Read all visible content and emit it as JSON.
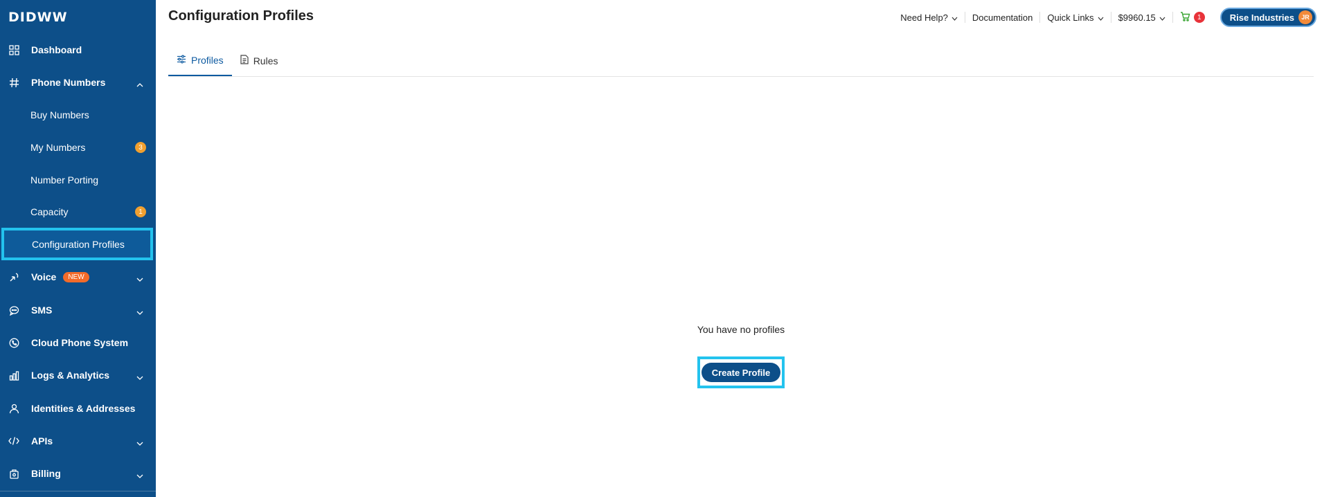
{
  "brand": {
    "logo": "DIDWW"
  },
  "page": {
    "title": "Configuration Profiles"
  },
  "topbar": {
    "need_help": "Need Help?",
    "documentation": "Documentation",
    "quick_links": "Quick Links",
    "balance": "$9960.15",
    "cart_count": "1",
    "account_name": "Rise Industries",
    "avatar_initials": "JR"
  },
  "sidebar": {
    "items": [
      {
        "label": "Dashboard"
      },
      {
        "label": "Phone Numbers"
      },
      {
        "label": "Buy Numbers"
      },
      {
        "label": "My Numbers",
        "badge": "3"
      },
      {
        "label": "Number Porting"
      },
      {
        "label": "Capacity",
        "badge": "1"
      },
      {
        "label": "Configuration Profiles"
      },
      {
        "label": "Voice",
        "tag": "NEW"
      },
      {
        "label": "SMS"
      },
      {
        "label": "Cloud Phone System"
      },
      {
        "label": "Logs & Analytics"
      },
      {
        "label": "Identities & Addresses"
      },
      {
        "label": "APIs"
      },
      {
        "label": "Billing"
      }
    ]
  },
  "tabs": [
    {
      "label": "Profiles",
      "active": true
    },
    {
      "label": "Rules",
      "active": false
    }
  ],
  "empty_state": {
    "message": "You have no profiles",
    "button": "Create Profile"
  },
  "colors": {
    "sidebar_bg": "#0d4f89",
    "highlight": "#23c3ee",
    "badge": "#f0a030",
    "new_tag": "#f26b2a",
    "cart_badge": "#e8333a"
  }
}
